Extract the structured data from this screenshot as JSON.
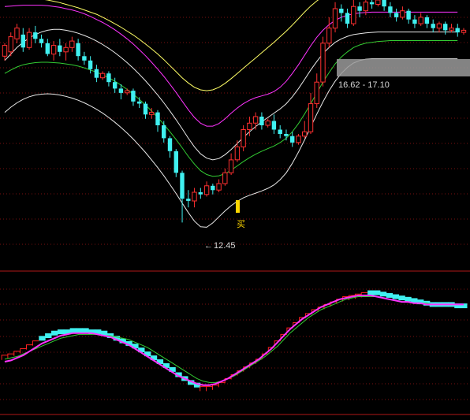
{
  "colors": {
    "background": "#000000",
    "grid": "#7a1010",
    "divider": "#b01818",
    "up_candle": "#ff3030",
    "down_candle": "#40f0f0",
    "band_outer_upper": "#ffff66",
    "band_mid_upper": "#ff33ff",
    "band_inner_upper": "#e8e8e8",
    "band_middle": "#33cc33",
    "band_lower": "#e8e8e8",
    "step_up": "#ff2020",
    "step_down": "#40f0f0",
    "osc_fast": "#ff33ff",
    "osc_slow": "#33cc33",
    "buy_marker": "#ffd700",
    "range_box": "#9a9a9a"
  },
  "annotations": {
    "low_label": "12.45",
    "low_arrow": "←",
    "buy_label": "买",
    "range_label": "16.62 - 17.10"
  },
  "chart_data": [
    {
      "type": "candlestick",
      "panel": "price",
      "ylim": [
        11.8,
        17.6
      ],
      "x": [
        0,
        1,
        2,
        3,
        4,
        5,
        6,
        7,
        8,
        9,
        10,
        11,
        12,
        13,
        14,
        15,
        15,
        16,
        17,
        18,
        19,
        20,
        21,
        22,
        23,
        24,
        25,
        26,
        27,
        28,
        29,
        30,
        31,
        32,
        33,
        34,
        35,
        36,
        37,
        38,
        39,
        40,
        41,
        42,
        43,
        44,
        45,
        46,
        47,
        48,
        49,
        50,
        51,
        52,
        53,
        54,
        55,
        56,
        57,
        58,
        59,
        60,
        61,
        62,
        63,
        64,
        65,
        66,
        67,
        68,
        69,
        70,
        71,
        72,
        73,
        74
      ],
      "candles": [
        [
          16.3,
          16.55,
          16.2,
          16.6
        ],
        [
          16.4,
          16.75,
          16.3,
          16.85
        ],
        [
          16.7,
          16.95,
          16.6,
          17.05
        ],
        [
          16.8,
          16.5,
          16.4,
          16.95
        ],
        [
          16.5,
          16.85,
          16.45,
          16.95
        ],
        [
          16.85,
          16.7,
          16.6,
          17.0
        ],
        [
          16.7,
          16.6,
          16.5,
          16.8
        ],
        [
          16.6,
          16.35,
          16.3,
          16.7
        ],
        [
          16.35,
          16.55,
          16.2,
          16.65
        ],
        [
          16.55,
          16.4,
          16.3,
          16.7
        ],
        [
          16.4,
          16.5,
          16.2,
          16.6
        ],
        [
          16.5,
          16.65,
          16.4,
          16.75
        ],
        [
          16.6,
          16.3,
          16.2,
          16.7
        ],
        [
          16.3,
          16.2,
          16.1,
          16.4
        ],
        [
          16.2,
          16.0,
          15.9,
          16.3
        ],
        [
          16.0,
          15.8,
          15.7,
          16.1
        ],
        [
          15.8,
          15.9,
          15.75,
          15.95
        ],
        [
          15.9,
          15.7,
          15.6,
          15.95
        ],
        [
          15.7,
          15.55,
          15.45,
          15.8
        ],
        [
          15.55,
          15.45,
          15.3,
          15.65
        ],
        [
          15.45,
          15.5,
          15.4,
          15.55
        ],
        [
          15.5,
          15.25,
          15.15,
          15.55
        ],
        [
          15.25,
          15.2,
          15.1,
          15.35
        ],
        [
          15.2,
          14.95,
          14.85,
          15.25
        ],
        [
          14.95,
          15.0,
          14.85,
          15.1
        ],
        [
          15.0,
          14.7,
          14.55,
          15.05
        ],
        [
          14.7,
          14.4,
          14.3,
          14.8
        ],
        [
          14.4,
          14.1,
          13.95,
          14.45
        ],
        [
          14.1,
          13.6,
          13.5,
          14.15
        ],
        [
          13.6,
          13.0,
          12.45,
          13.65
        ],
        [
          13.0,
          12.95,
          12.8,
          13.2
        ],
        [
          12.95,
          13.15,
          12.8,
          13.25
        ],
        [
          13.15,
          13.1,
          13.0,
          13.25
        ],
        [
          13.1,
          13.3,
          13.05,
          13.4
        ],
        [
          13.3,
          13.2,
          13.1,
          13.35
        ],
        [
          13.2,
          13.35,
          13.15,
          13.45
        ],
        [
          13.35,
          13.6,
          13.3,
          13.7
        ],
        [
          13.6,
          13.9,
          13.55,
          14.05
        ],
        [
          13.9,
          14.2,
          13.85,
          14.35
        ],
        [
          14.2,
          14.6,
          14.1,
          14.7
        ],
        [
          14.6,
          14.75,
          14.45,
          14.9
        ],
        [
          14.75,
          14.9,
          14.6,
          15.0
        ],
        [
          14.9,
          14.7,
          14.6,
          15.0
        ],
        [
          14.7,
          14.8,
          14.65,
          14.85
        ],
        [
          14.8,
          14.6,
          14.5,
          14.95
        ],
        [
          14.6,
          14.5,
          14.4,
          14.7
        ],
        [
          14.5,
          14.45,
          14.35,
          14.6
        ],
        [
          14.45,
          14.3,
          14.2,
          14.55
        ],
        [
          14.3,
          14.45,
          14.25,
          14.5
        ],
        [
          14.45,
          14.55,
          14.4,
          14.8
        ],
        [
          14.55,
          15.2,
          14.5,
          15.45
        ],
        [
          15.2,
          15.7,
          15.1,
          15.9
        ],
        [
          15.7,
          16.6,
          15.6,
          16.75
        ],
        [
          16.6,
          16.95,
          16.5,
          17.2
        ],
        [
          16.95,
          17.4,
          16.85,
          17.55
        ],
        [
          17.4,
          17.3,
          17.1,
          17.5
        ],
        [
          17.3,
          17.05,
          16.95,
          17.4
        ],
        [
          17.05,
          17.45,
          17.0,
          17.6
        ],
        [
          17.45,
          17.35,
          17.2,
          17.55
        ],
        [
          17.35,
          17.55,
          17.25,
          17.6
        ],
        [
          17.55,
          17.5,
          17.4,
          17.6
        ],
        [
          17.5,
          17.6,
          17.45,
          17.6
        ],
        [
          17.6,
          17.45,
          17.35,
          17.6
        ],
        [
          17.45,
          17.3,
          17.2,
          17.55
        ],
        [
          17.3,
          17.2,
          17.1,
          17.4
        ],
        [
          17.2,
          17.35,
          17.15,
          17.45
        ],
        [
          17.35,
          17.15,
          17.05,
          17.4
        ],
        [
          17.15,
          17.05,
          16.95,
          17.25
        ],
        [
          17.05,
          17.2,
          17.0,
          17.3
        ],
        [
          17.2,
          17.05,
          16.95,
          17.25
        ],
        [
          17.05,
          16.95,
          16.85,
          17.15
        ],
        [
          16.95,
          17.05,
          16.85,
          17.1
        ],
        [
          17.05,
          16.9,
          16.8,
          17.1
        ],
        [
          16.9,
          16.95,
          16.85,
          17.05
        ],
        [
          16.95,
          16.85,
          16.75,
          17.05
        ],
        [
          16.85,
          16.9,
          16.8,
          16.95
        ]
      ],
      "band_outer_upper": [
        17.75,
        17.72,
        17.7,
        17.68,
        17.66,
        17.64,
        17.62,
        17.6,
        17.57,
        17.54,
        17.5,
        17.46,
        17.42,
        17.37,
        17.32,
        17.27,
        17.2,
        17.13,
        17.05,
        16.97,
        16.88,
        16.79,
        16.69,
        16.58,
        16.47,
        16.35,
        16.22,
        16.08,
        15.94,
        15.8,
        15.68,
        15.58,
        15.52,
        15.5,
        15.52,
        15.58,
        15.67,
        15.78,
        15.9,
        16.02,
        16.14,
        16.26,
        16.38,
        16.5,
        16.62,
        16.75,
        16.88,
        17.02,
        17.17,
        17.32,
        17.46,
        17.58,
        17.68,
        17.75,
        17.78,
        17.78,
        17.78,
        17.78,
        17.78,
        17.78,
        17.78,
        17.78,
        17.78,
        17.78,
        17.78,
        17.78,
        17.78,
        17.78,
        17.78,
        17.78,
        17.78,
        17.78,
        17.78,
        17.78,
        17.78
      ],
      "band_mid_upper": [
        17.45,
        17.46,
        17.47,
        17.48,
        17.48,
        17.48,
        17.48,
        17.47,
        17.45,
        17.43,
        17.4,
        17.37,
        17.33,
        17.28,
        17.22,
        17.15,
        17.08,
        17.0,
        16.91,
        16.81,
        16.7,
        16.58,
        16.45,
        16.31,
        16.16,
        16.0,
        15.83,
        15.65,
        15.46,
        15.26,
        15.06,
        14.88,
        14.75,
        14.68,
        14.68,
        14.74,
        14.85,
        14.98,
        15.1,
        15.2,
        15.28,
        15.34,
        15.38,
        15.42,
        15.48,
        15.58,
        15.72,
        15.9,
        16.1,
        16.32,
        16.54,
        16.74,
        16.9,
        17.03,
        17.13,
        17.2,
        17.25,
        17.28,
        17.3,
        17.31,
        17.32,
        17.32,
        17.32,
        17.32,
        17.32,
        17.32,
        17.32,
        17.32,
        17.32,
        17.32,
        17.32,
        17.32,
        17.32,
        17.32,
        17.32
      ],
      "band_inner_upper": [
        16.2,
        16.35,
        16.5,
        16.62,
        16.72,
        16.8,
        16.86,
        16.9,
        16.92,
        16.92,
        16.9,
        16.87,
        16.83,
        16.78,
        16.72,
        16.65,
        16.57,
        16.48,
        16.38,
        16.27,
        16.15,
        16.02,
        15.88,
        15.73,
        15.57,
        15.4,
        15.22,
        15.03,
        14.83,
        14.62,
        14.4,
        14.2,
        14.04,
        13.94,
        13.9,
        13.93,
        14.02,
        14.14,
        14.28,
        14.42,
        14.55,
        14.67,
        14.78,
        14.88,
        14.98,
        15.08,
        15.2,
        15.36,
        15.55,
        15.76,
        15.98,
        16.18,
        16.36,
        16.5,
        16.62,
        16.7,
        16.76,
        16.8,
        16.82,
        16.84,
        16.85,
        16.86,
        16.86,
        16.86,
        16.86,
        16.86,
        16.86,
        16.86,
        16.86,
        16.86,
        16.86,
        16.86,
        16.86,
        16.86,
        16.86
      ],
      "band_middle": [
        15.9,
        15.98,
        16.05,
        16.1,
        16.13,
        16.15,
        16.16,
        16.16,
        16.15,
        16.14,
        16.12,
        16.1,
        16.07,
        16.03,
        15.98,
        15.93,
        15.87,
        15.8,
        15.72,
        15.63,
        15.53,
        15.42,
        15.3,
        15.17,
        15.03,
        14.88,
        14.72,
        14.55,
        14.37,
        14.18,
        13.98,
        13.8,
        13.65,
        13.56,
        13.52,
        13.53,
        13.58,
        13.66,
        13.76,
        13.86,
        13.95,
        14.03,
        14.1,
        14.16,
        14.22,
        14.3,
        14.4,
        14.55,
        14.74,
        14.96,
        15.2,
        15.45,
        15.7,
        15.92,
        16.12,
        16.28,
        16.4,
        16.5,
        16.56,
        16.6,
        16.62,
        16.64,
        16.65,
        16.66,
        16.66,
        16.66,
        16.66,
        16.66,
        16.66,
        16.66,
        16.66,
        16.66,
        16.66,
        16.66,
        16.66
      ],
      "band_lower": [
        15.0,
        15.12,
        15.22,
        15.3,
        15.36,
        15.4,
        15.42,
        15.43,
        15.42,
        15.4,
        15.37,
        15.33,
        15.28,
        15.22,
        15.15,
        15.07,
        14.98,
        14.88,
        14.77,
        14.65,
        14.52,
        14.38,
        14.23,
        14.07,
        13.9,
        13.72,
        13.53,
        13.33,
        13.12,
        12.9,
        12.68,
        12.48,
        12.35,
        12.34,
        12.44,
        12.58,
        12.72,
        12.84,
        12.94,
        13.02,
        13.08,
        13.13,
        13.18,
        13.24,
        13.32,
        13.44,
        13.6,
        13.82,
        14.08,
        14.36,
        14.66,
        14.96,
        15.24,
        15.5,
        15.72,
        15.9,
        16.04,
        16.14,
        16.2,
        16.23,
        16.24,
        16.24,
        16.24,
        16.24,
        16.24,
        16.24,
        16.24,
        16.24,
        16.24,
        16.24,
        16.24,
        16.24,
        16.24,
        16.24,
        16.24
      ]
    },
    {
      "type": "step",
      "panel": "oscillator",
      "ylim": [
        0,
        100
      ],
      "step_values": [
        45,
        46,
        48,
        50,
        53,
        56,
        58,
        60,
        62,
        63,
        63,
        64,
        64,
        64,
        63,
        63,
        62,
        60,
        58,
        56,
        54,
        52,
        49,
        46,
        43,
        40,
        37,
        34,
        30,
        27,
        24,
        22,
        21,
        21,
        22,
        24,
        27,
        30,
        33,
        36,
        39,
        42,
        46,
        51,
        56,
        61,
        66,
        70,
        74,
        77,
        80,
        82,
        84,
        86,
        88,
        90,
        91,
        92,
        93,
        93,
        93,
        92,
        91,
        90,
        89,
        88,
        87,
        86,
        85,
        84,
        84,
        84,
        84,
        83,
        83
      ],
      "step_colors": [
        "up",
        "up",
        "up",
        "up",
        "up",
        "up",
        "down",
        "down",
        "down",
        "down",
        "down",
        "down",
        "down",
        "down",
        "down",
        "down",
        "down",
        "down",
        "down",
        "down",
        "down",
        "down",
        "down",
        "down",
        "down",
        "down",
        "down",
        "down",
        "down",
        "down",
        "down",
        "down",
        "up",
        "up",
        "up",
        "up",
        "up",
        "up",
        "up",
        "up",
        "up",
        "up",
        "up",
        "up",
        "up",
        "up",
        "up",
        "up",
        "up",
        "up",
        "up",
        "up",
        "up",
        "up",
        "up",
        "up",
        "up",
        "up",
        "up",
        "down",
        "down",
        "down",
        "down",
        "down",
        "down",
        "down",
        "down",
        "down",
        "down",
        "down",
        "down",
        "down",
        "down",
        "down",
        "down"
      ],
      "fast_line": [
        40,
        41,
        43,
        45,
        48,
        51,
        54,
        56,
        58,
        60,
        61,
        62,
        62,
        62,
        62,
        61,
        60,
        59,
        57,
        55,
        53,
        50,
        47,
        44,
        41,
        38,
        35,
        32,
        29,
        27,
        25,
        23,
        22,
        22,
        23,
        25,
        27,
        30,
        33,
        36,
        39,
        42,
        46,
        50,
        55,
        60,
        65,
        69,
        73,
        76,
        79,
        82,
        84,
        86,
        88,
        89,
        90,
        91,
        91,
        91,
        90,
        89,
        88,
        87,
        86,
        86,
        85,
        85,
        84,
        84,
        84,
        84,
        84,
        84,
        84
      ],
      "slow_line": [
        42,
        43,
        44,
        46,
        48,
        50,
        52,
        54,
        56,
        58,
        59,
        60,
        61,
        61,
        61,
        61,
        60,
        60,
        59,
        58,
        57,
        55,
        53,
        51,
        48,
        45,
        42,
        39,
        36,
        33,
        30,
        27,
        25,
        24,
        24,
        25,
        27,
        29,
        32,
        35,
        38,
        41,
        44,
        48,
        52,
        57,
        62,
        66,
        70,
        74,
        77,
        80,
        82,
        84,
        86,
        88,
        89,
        90,
        90,
        90,
        90,
        89,
        88,
        87,
        86,
        86,
        85,
        85,
        85,
        84,
        84,
        84,
        84,
        84,
        84
      ]
    }
  ]
}
